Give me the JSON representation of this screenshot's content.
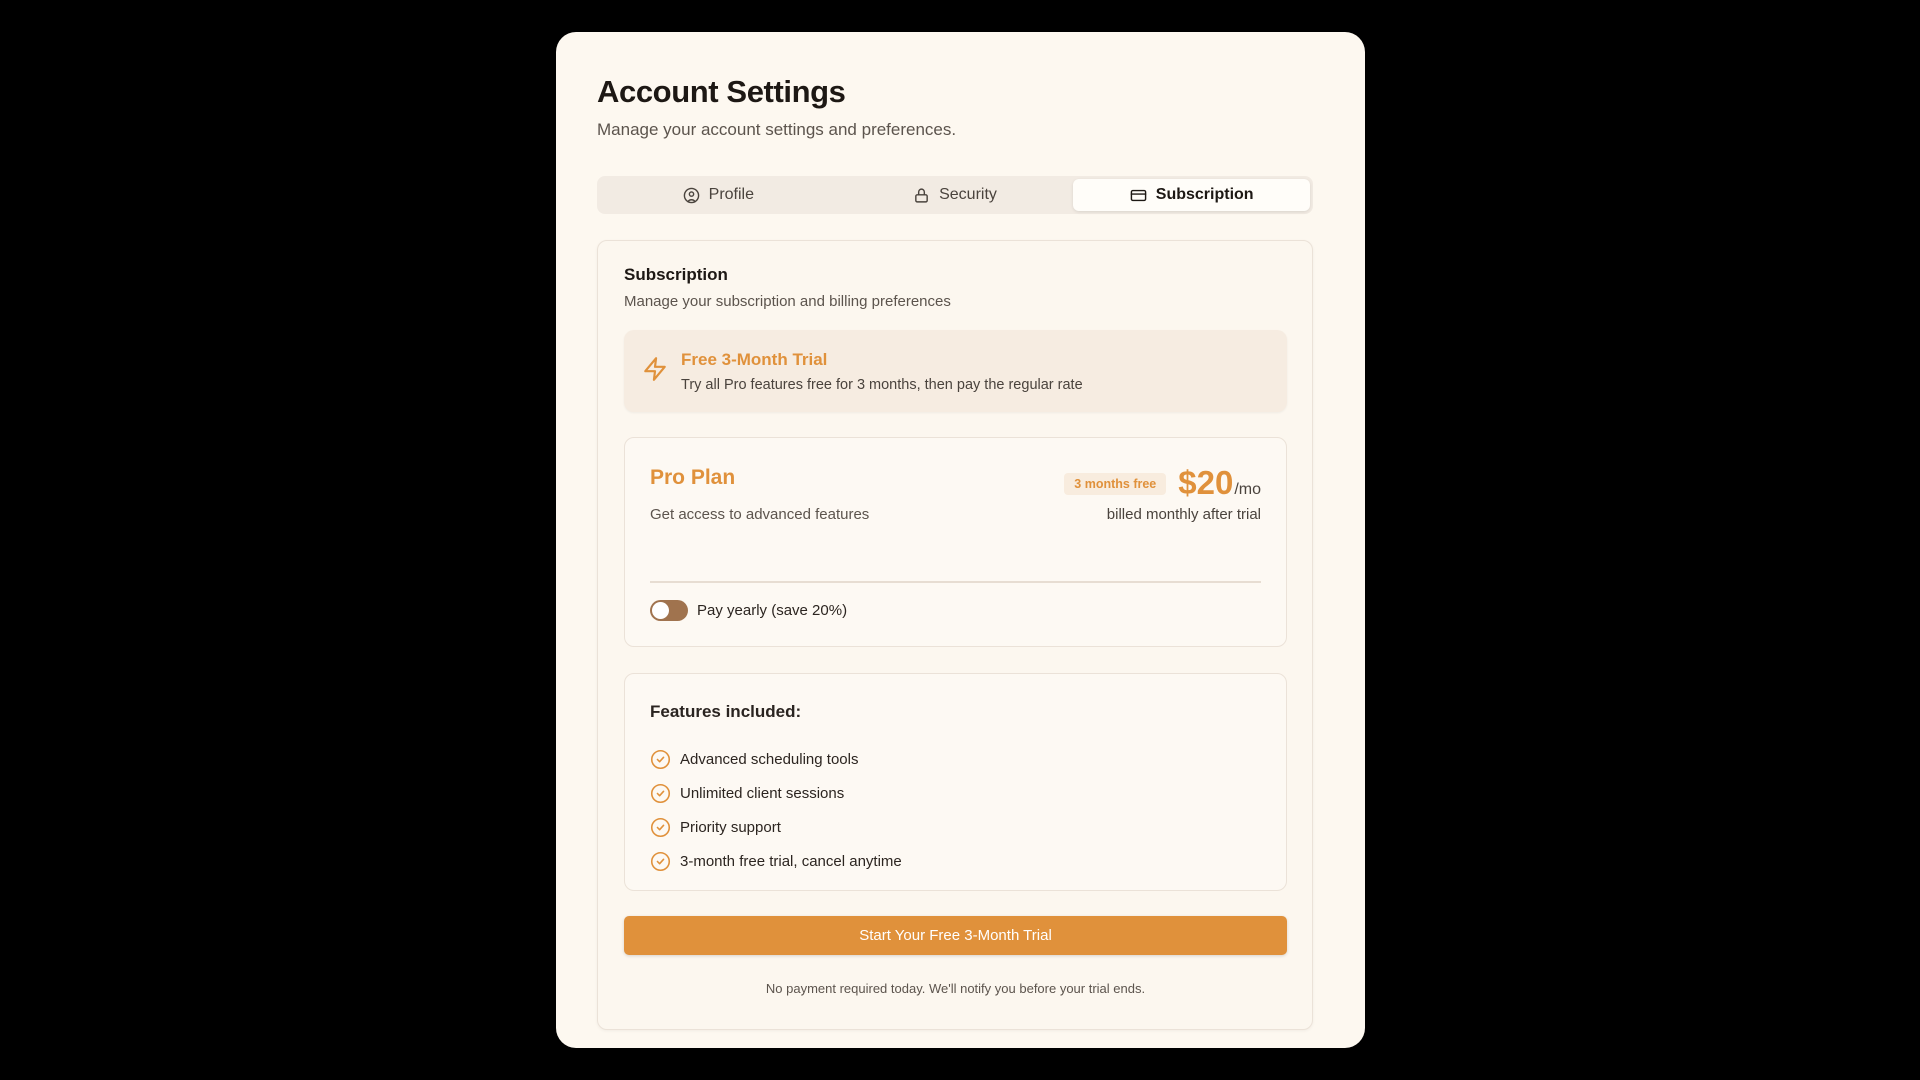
{
  "header": {
    "title": "Account Settings",
    "subtitle": "Manage your account settings and preferences."
  },
  "tabs": [
    {
      "label": "Profile",
      "icon": "user-circle-icon",
      "active": false
    },
    {
      "label": "Security",
      "icon": "lock-icon",
      "active": false
    },
    {
      "label": "Subscription",
      "icon": "credit-card-icon",
      "active": true
    }
  ],
  "subscription": {
    "title": "Subscription",
    "subtitle": "Manage your subscription and billing preferences",
    "trial": {
      "icon": "lightning-icon",
      "title": "Free 3-Month Trial",
      "description": "Try all Pro features free for 3 months, then pay the regular rate"
    },
    "plan": {
      "name": "Pro Plan",
      "description": "Get access to advanced features",
      "badge": "3 months free",
      "price": "$20",
      "period": "/mo",
      "billing_note": "billed monthly after trial",
      "yearly_toggle_label": "Pay yearly (save 20%)",
      "yearly_enabled": false
    },
    "features": {
      "title": "Features included:",
      "items": [
        "Advanced scheduling tools",
        "Unlimited client sessions",
        "Priority support",
        "3-month free trial, cancel anytime"
      ]
    },
    "cta_label": "Start Your Free 3-Month Trial",
    "footnote": "No payment required today. We'll notify you before your trial ends."
  },
  "colors": {
    "accent": "#e0913b",
    "background": "#fdf8f0",
    "toggle": "#a0734e"
  }
}
